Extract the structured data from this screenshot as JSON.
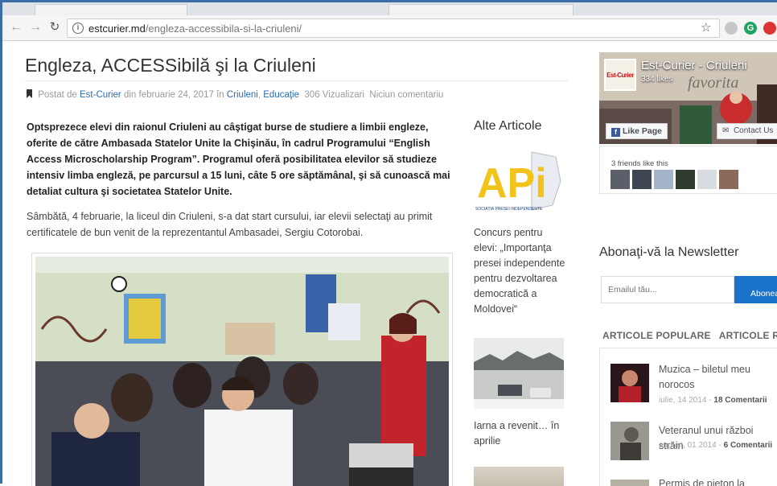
{
  "browser": {
    "url_host": "estcurier.md",
    "url_path": "/engleza-accessibila-si-la-criuleni/",
    "back_icon": "back-arrow-icon",
    "forward_icon": "forward-arrow-icon",
    "reload_icon": "reload-icon",
    "info_icon": "info-icon",
    "star_icon": "star-icon",
    "extensions": [
      "extension-icon",
      "grammarly-icon",
      "adblock-icon"
    ]
  },
  "article": {
    "title": "Engleza, ACCESSibilă şi la Criuleni",
    "meta": {
      "posted_by_label": "Postat de",
      "author": "Est-Curier",
      "date_text": "din februarie 24, 2017",
      "in_label": "în",
      "cat1": "Criuleni",
      "cat2": "Educaţie",
      "views": "306 Vizualizari",
      "comments": "Niciun comentariu"
    },
    "lead": "Optsprezece elevi din raionul Criuleni au câştigat burse de studiere a limbii engleze, oferite de către Ambasada Statelor Unite la Chişinău, în cadrul Programului “English Access Microscholarship Program”. Programul oferă posibilitatea elevilor să studieze intensiv limba engleză, pe parcursul a 15 luni, câte 5 ore săptămânal, şi să cunoască mai detaliat cultura şi societatea Statelor Unite.",
    "paragraph": "Sâmbătă, 4 februarie, la liceul din Criuleni, s-a dat start cursului, iar elevii selectaţi au primit certificatele de bun venit de la reprezentantul Ambasadei, Sergiu Cotorobai."
  },
  "alte": {
    "heading": "Alte Articole",
    "logo_text": "APi",
    "logo_caption": "SOCIAŢIA PRESEI INDEPENDENTE",
    "items": [
      {
        "title": "Concurs pentru elevi: „Importanţa presei independente pentru dezvoltarea democratică a Moldovei“"
      },
      {
        "title": "Iarna a revenit… în aprilie"
      }
    ]
  },
  "facebook": {
    "page_name": "Est-Curier - Criuleni",
    "likes": "334 likes",
    "avatar_text": "Est-Curier",
    "like_button": "Like Page",
    "contact_button": "Contact Us",
    "friends_text": "3 friends like this",
    "bg_words": "favorita"
  },
  "newsletter": {
    "heading": "Abonaţi-vă la Newsletter",
    "placeholder": "Emailul tău...",
    "button": "Abonează-te"
  },
  "popular": {
    "tabs": [
      "ARTICOLE POPULARE",
      "ARTICOLE RECENTE"
    ],
    "items": [
      {
        "title": "Muzica – biletul meu norocos",
        "date": "iulie, 14 2014 -",
        "comments": "18 Comentarii"
      },
      {
        "title": "Veteranul unui război străin",
        "date": "august, 01 2014 -",
        "comments": "6 Comentarii"
      },
      {
        "title": "Permis de pieton la Boscana"
      }
    ]
  },
  "colors": {
    "link": "#2a6db5",
    "button_blue": "#1a73c9",
    "facebook_blue": "#3b5998"
  }
}
